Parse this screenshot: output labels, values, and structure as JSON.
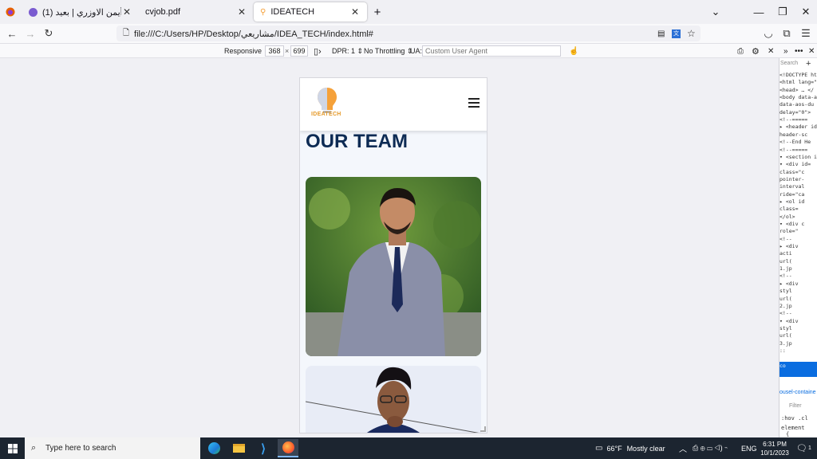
{
  "tabs": [
    {
      "title": "أيمن الاوزري | بعيد (1)",
      "icon": "avatar-icon"
    },
    {
      "title": "cvjob.pdf",
      "icon": "pdf-icon"
    },
    {
      "title": "IDEATECH",
      "icon": "site-favicon",
      "active": true
    }
  ],
  "browser": {
    "url": "file:///C:/Users/HP/Desktop/مشاريعي/IDEA_TECH/index.html#",
    "new_tab": "+"
  },
  "rdm": {
    "device": "Responsive",
    "width": "368",
    "times": "×",
    "height": "699",
    "dpr": "DPR: 1",
    "throttling": "No Throttling",
    "ua_label": "UA:",
    "ua_placeholder": "Custom User Agent"
  },
  "site": {
    "logo_text": "IDEATECH",
    "team_heading": "OUR TEAM",
    "scroll_top": "↑"
  },
  "devtools": {
    "search_placeholder": "Search",
    "lines": [
      "<!DOCTYPE htm",
      "<html lang=\"e",
      "  <head> … </",
      "  <body data-a",
      "  data-aos-du",
      "  delay=\"0\">",
      "    <!--=====",
      "    ▸ <header id",
      "    header-sc",
      "    <!--End He",
      "    <!--=====",
      "    ▾ <section i",
      "      ▾ <div id=",
      "        class=\"c",
      "        pointer-",
      "        interval",
      "        ride=\"ca",
      "        ▸ <ol id",
      "          class=",
      "          </ol>",
      "        ▾ <div c",
      "          role=\"",
      "            <!--",
      "          ▸ <div",
      "            acti",
      "            url(",
      "            1.jp",
      "            <!--",
      "          ▸ <div",
      "            styl",
      "            url(",
      "            2.jp",
      "            <!--",
      "          ▾ <div",
      "            styl",
      "            url(",
      "            3.jp",
      "            ::",
      "            ▸ <d",
      "              co"
    ],
    "breadcrumb": "ousel-containe",
    "filter": "Filter",
    "hov": ":hov  .cl",
    "element": "element",
    "brace": "{"
  },
  "taskbar": {
    "search_placeholder": "Type here to search",
    "weather_temp": "66°F",
    "weather_desc": "Mostly clear",
    "lang": "ENG",
    "time": "6:31 PM",
    "date": "10/1/2023",
    "notif_count": "1"
  },
  "colors": {
    "heading": "#0d2b54",
    "accent_orange": "#f5a13a",
    "devtools_selection": "#0a6de0"
  }
}
